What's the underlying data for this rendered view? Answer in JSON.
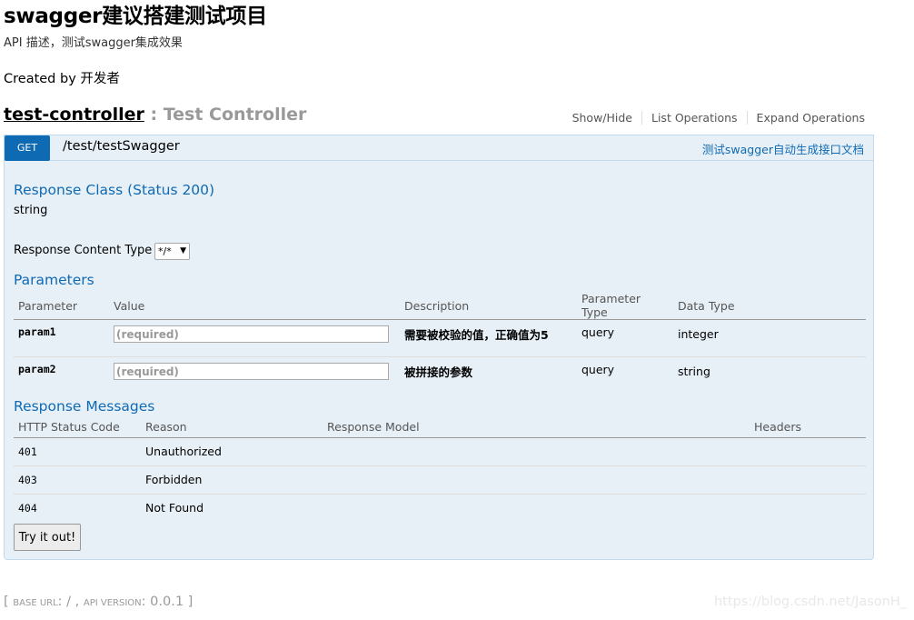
{
  "info": {
    "title": "swagger建议搭建测试项目",
    "description": "API 描述，测试swagger集成效果",
    "created_by": "Created by 开发者"
  },
  "resource": {
    "name": "test-controller",
    "separator_desc": " : Test Controller",
    "links": [
      "Show/Hide",
      "List Operations",
      "Expand Operations"
    ]
  },
  "operation": {
    "method": "GET",
    "path": "/test/testSwagger",
    "summary": "测试swagger自动生成接口文档",
    "response_class_title": "Response Class (Status 200)",
    "response_class_value": "string",
    "content_type_label": "Response Content Type",
    "content_type_value": "*/*",
    "parameters_title": "Parameters",
    "param_headers": [
      "Parameter",
      "Value",
      "Description",
      "Parameter Type",
      "Data Type"
    ],
    "params": [
      {
        "name": "param1",
        "placeholder": "(required)",
        "description": "需要被校验的值，正确值为5",
        "type": "query",
        "data_type": "integer"
      },
      {
        "name": "param2",
        "placeholder": "(required)",
        "description": "被拼接的参数",
        "type": "query",
        "data_type": "string"
      }
    ],
    "messages_title": "Response Messages",
    "msg_headers": [
      "HTTP Status Code",
      "Reason",
      "Response Model",
      "Headers"
    ],
    "messages": [
      {
        "code": "401",
        "reason": "Unauthorized"
      },
      {
        "code": "403",
        "reason": "Forbidden"
      },
      {
        "code": "404",
        "reason": "Not Found"
      }
    ],
    "try_label": "Try it out!"
  },
  "footer": {
    "open": "[ ",
    "base_url_label": "base url",
    "base_url_value": ": / , ",
    "api_version_label": "api version",
    "api_version_value": ": 0.0.1 ]"
  },
  "watermark": "https://blog.csdn.net/JasonH_"
}
